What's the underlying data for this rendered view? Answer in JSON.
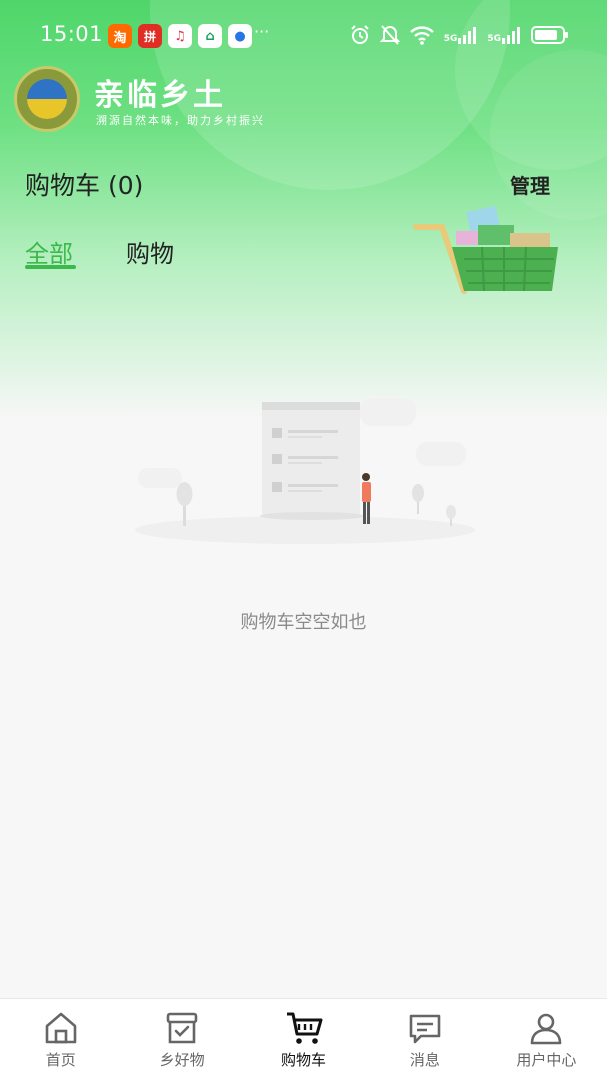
{
  "status_bar": {
    "time": "15:01",
    "more": "···",
    "network_1": "5G",
    "network_2": "5G"
  },
  "brand": {
    "name": "亲临乡土",
    "slogan": "溯源自然本味，助力乡村振兴"
  },
  "header": {
    "title": "购物车 (0)",
    "manage_label": "管理"
  },
  "tabs": [
    {
      "label": "全部",
      "active": true
    },
    {
      "label": "购物",
      "active": false
    }
  ],
  "empty_state": {
    "message": "购物车空空如也"
  },
  "bottom_nav": [
    {
      "label": "首页",
      "icon": "home-icon",
      "active": false
    },
    {
      "label": "乡好物",
      "icon": "goods-box-icon",
      "active": false
    },
    {
      "label": "购物车",
      "icon": "cart-icon",
      "active": true
    },
    {
      "label": "消息",
      "icon": "message-icon",
      "active": false
    },
    {
      "label": "用户中心",
      "icon": "user-icon",
      "active": false
    }
  ],
  "colors": {
    "accent_green": "#3cb84c",
    "header_green": "#4fd66a"
  }
}
